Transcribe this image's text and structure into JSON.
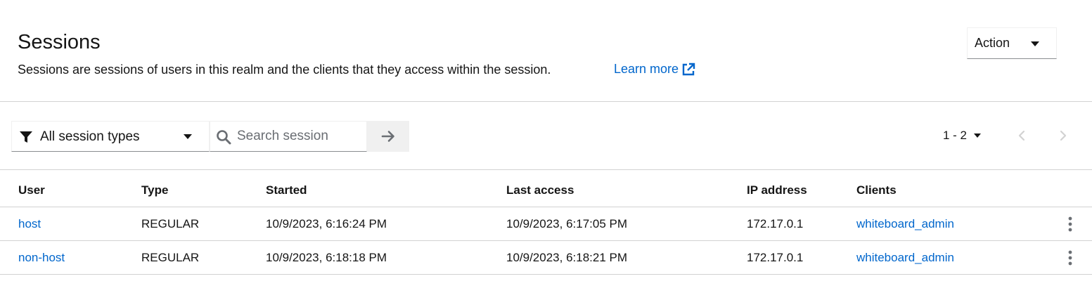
{
  "header": {
    "title": "Sessions",
    "description": "Sessions are sessions of users in this realm and the clients that they access within the session.",
    "learn_more": "Learn more",
    "action_label": "Action"
  },
  "toolbar": {
    "type_filter": "All session types",
    "search_placeholder": "Search session",
    "pagination_range": "1 - 2"
  },
  "table": {
    "columns": [
      "User",
      "Type",
      "Started",
      "Last access",
      "IP address",
      "Clients"
    ],
    "rows": [
      {
        "user": "host",
        "type": "REGULAR",
        "started": "10/9/2023, 6:16:24 PM",
        "last_access": "10/9/2023, 6:17:05 PM",
        "ip": "172.17.0.1",
        "clients": "whiteboard_admin"
      },
      {
        "user": "non-host",
        "type": "REGULAR",
        "started": "10/9/2023, 6:18:18 PM",
        "last_access": "10/9/2023, 6:18:21 PM",
        "ip": "172.17.0.1",
        "clients": "whiteboard_admin"
      }
    ]
  },
  "colors": {
    "link": "#0066cc",
    "text": "#151515",
    "border": "#d2d2d2",
    "muted": "#6a6e73"
  },
  "icons": {
    "learn_more": "external-link-icon",
    "filter": "filter-icon",
    "search": "search-icon",
    "search_go": "arrow-right-icon",
    "prev": "chevron-left-icon",
    "next": "chevron-right-icon",
    "row_actions": "kebab-icon"
  }
}
